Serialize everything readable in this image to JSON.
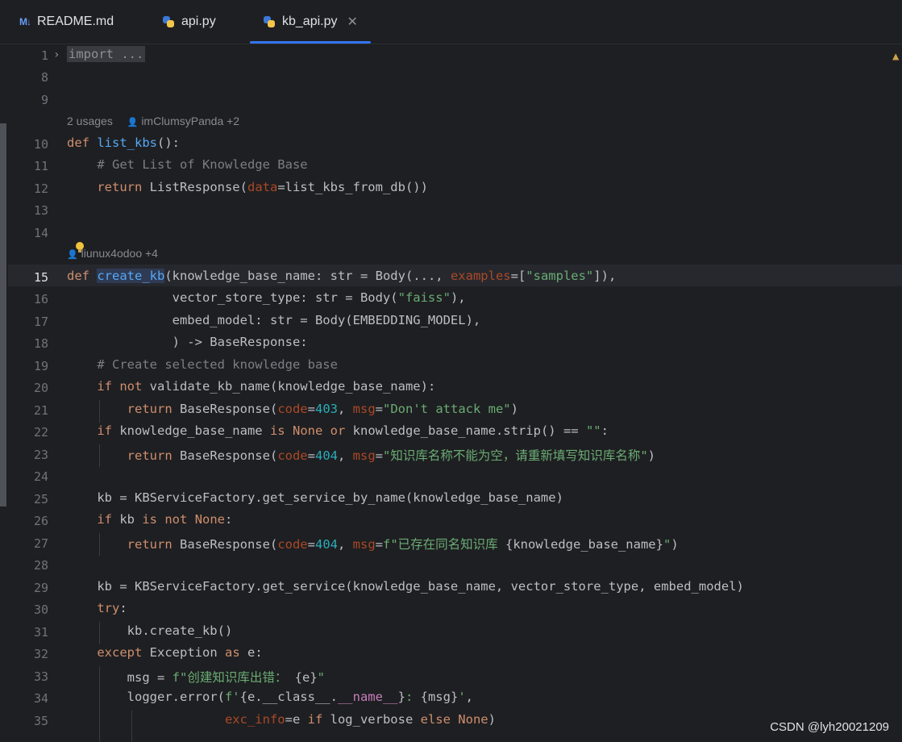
{
  "tabs": [
    {
      "label": "README.md",
      "icon": "markdown-icon",
      "icon_text": "M↓"
    },
    {
      "label": "api.py",
      "icon": "python-icon"
    },
    {
      "label": "kb_api.py",
      "icon": "python-icon",
      "active": true,
      "close": "✕"
    }
  ],
  "accent_color": "#3574f0",
  "line_numbers": [
    "1",
    "8",
    "9",
    "10",
    "11",
    "12",
    "13",
    "14",
    "15",
    "16",
    "17",
    "18",
    "19",
    "20",
    "21",
    "22",
    "23",
    "24",
    "25",
    "26",
    "27",
    "28",
    "29",
    "30",
    "31",
    "32",
    "33",
    "34",
    "35"
  ],
  "current_line": "15",
  "hints": {
    "list_kbs": {
      "usages": "2 usages",
      "authors": "imClumsyPanda +2"
    },
    "create_kb": {
      "authors": "liunux4odoo +4"
    }
  },
  "code": {
    "l1": "import ...",
    "l10_def": "def",
    "l10_name": "list_kbs",
    "l10_rest": "():",
    "l11": "    # Get List of Knowledge Base",
    "l12_kw": "return",
    "l12_a": " ListResponse(",
    "l12_p": "data",
    "l12_b": "=list_kbs_from_db())",
    "l15_def": "def",
    "l15_name": "create_kb",
    "l15_a": "(knowledge_base_name: str = Body(..., ",
    "l15_p": "examples",
    "l15_b": "=[",
    "l15_s": "\"samples\"",
    "l15_c": "]),",
    "l16_a": "              vector_store_type: str = Body(",
    "l16_s": "\"faiss\"",
    "l16_b": "),",
    "l17": "              embed_model: str = Body(EMBEDDING_MODEL),",
    "l18": "              ) -> BaseResponse:",
    "l19": "    # Create selected knowledge base",
    "l20_a": "if",
    "l20_b": "not",
    "l20_c": " validate_kb_name(knowledge_base_name):",
    "l21_kw": "return",
    "l21_a": " BaseResponse(",
    "l21_p1": "code",
    "l21_n": "403",
    "l21_p2": "msg",
    "l21_s": "\"Don't attack me\"",
    "l21_e": ")",
    "l22_if": "if",
    "l22_a": " knowledge_base_name ",
    "l22_is": "is",
    "l22_none": "None",
    "l22_or": "or",
    "l22_b": " knowledge_base_name.strip() == ",
    "l22_s": "\"\"",
    "l22_c": ":",
    "l23_kw": "return",
    "l23_a": " BaseResponse(",
    "l23_p1": "code",
    "l23_n": "404",
    "l23_p2": "msg",
    "l23_s": "\"知识库名称不能为空，请重新填写知识库名称\"",
    "l23_e": ")",
    "l25": "    kb = KBServiceFactory.get_service_by_name(knowledge_base_name)",
    "l26_if": "if",
    "l26_a": " kb ",
    "l26_is": "is",
    "l26_not": "not",
    "l26_none": "None",
    "l26_c": ":",
    "l27_kw": "return",
    "l27_a": " BaseResponse(",
    "l27_p1": "code",
    "l27_n": "404",
    "l27_p2": "msg",
    "l27_s1": "f\"已存在同名知识库 ",
    "l27_v": "{knowledge_base_name}",
    "l27_s2": "\"",
    "l27_e": ")",
    "l29": "    kb = KBServiceFactory.get_service(knowledge_base_name, vector_store_type, embed_model)",
    "l30": "try",
    "l31": "        kb.create_kb()",
    "l32_ex": "except",
    "l32_a": " Exception ",
    "l32_as": "as",
    "l32_b": " e:",
    "l33_a": "        msg = ",
    "l33_s1": "f\"创建知识库出错： ",
    "l33_v": "{e}",
    "l33_s2": "\"",
    "l34_a": "        logger.error(",
    "l34_s1": "f'",
    "l34_v1": "{e.__class__.",
    "l34_d": "__name__",
    "l34_v2": "}",
    "l34_s2": ": ",
    "l34_v3": "{msg}",
    "l34_s3": "'",
    "l34_e": ",",
    "l35_p": "exc_info",
    "l35_a": "=e ",
    "l35_if": "if",
    "l35_b": " log_verbose ",
    "l35_else": "else",
    "l35_none": "None",
    "l35_e": ")"
  },
  "watermark": "CSDN @lyh20021209"
}
